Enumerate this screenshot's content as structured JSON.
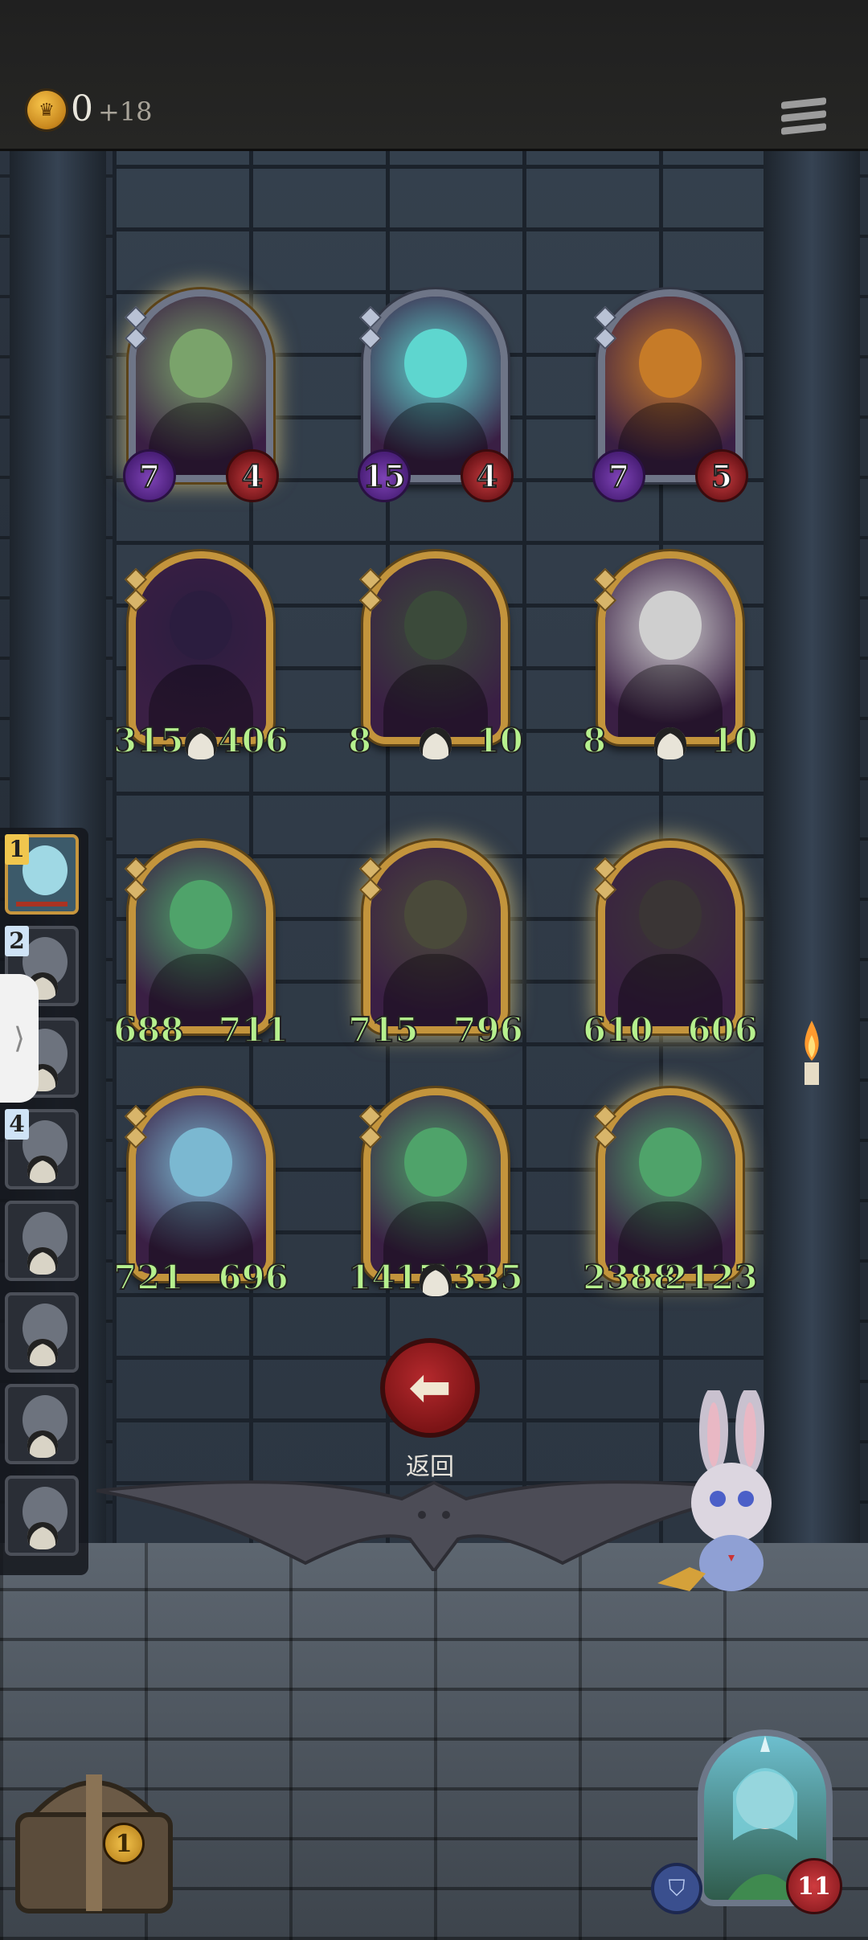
{
  "hud": {
    "gold": "0",
    "income": "+18",
    "coin_icon": "crown-coin-icon",
    "menu_icon": "menu-icon"
  },
  "board": {
    "cards": [
      {
        "atk": "7",
        "hp": "4",
        "frame": "silver",
        "glow": true,
        "theme": "#7aa36b"
      },
      {
        "atk": "15",
        "hp": "4",
        "frame": "silver",
        "glow": false,
        "theme": "#5ed6cf"
      },
      {
        "atk": "7",
        "hp": "5",
        "frame": "silver",
        "glow": false,
        "theme": "#c67b28"
      },
      {
        "atk": "315",
        "hp": "406",
        "frame": "gold",
        "glow": false,
        "theme": "#2b1d3f",
        "skull": true
      },
      {
        "atk": "8",
        "hp": "10",
        "frame": "gold",
        "glow": false,
        "theme": "#3b4a3a",
        "skull": true
      },
      {
        "atk": "8",
        "hp": "10",
        "frame": "gold",
        "glow": false,
        "theme": "#cfcfcf",
        "skull": true
      },
      {
        "atk": "688",
        "hp": "711",
        "frame": "gold",
        "glow": false,
        "theme": "#4fa36a"
      },
      {
        "atk": "715",
        "hp": "796",
        "frame": "gold",
        "glow": true,
        "theme": "#4a4a3a"
      },
      {
        "atk": "610",
        "hp": "606",
        "frame": "gold",
        "glow": true,
        "theme": "#3a3535"
      },
      {
        "atk": "721",
        "hp": "696",
        "frame": "gold",
        "glow": false,
        "theme": "#7bb8d1"
      },
      {
        "atk": "1417",
        "hp": "1335",
        "frame": "gold",
        "glow": false,
        "theme": "#4fa36a",
        "skull": true
      },
      {
        "atk": "2388",
        "hp": "2123",
        "frame": "gold",
        "glow": true,
        "theme": "#4fa36a"
      }
    ]
  },
  "back_button": {
    "label": "返回",
    "icon": "arrow-left-icon"
  },
  "opponents": [
    {
      "rank": "1",
      "active": true
    },
    {
      "rank": "2",
      "active": false
    },
    {
      "rank": "",
      "active": false
    },
    {
      "rank": "4",
      "active": false
    },
    {
      "rank": "",
      "active": false
    },
    {
      "rank": "",
      "active": false
    },
    {
      "rank": "",
      "active": false
    },
    {
      "rank": "",
      "active": false
    }
  ],
  "chest": {
    "count": "1",
    "icon": "treasure-chest-icon"
  },
  "hero": {
    "health": "11",
    "armor_icon": "shield-icon"
  },
  "colors": {
    "gold_frame": "#c3943c",
    "silver_frame": "#6e7587",
    "stat_green": "#b6f08e"
  }
}
